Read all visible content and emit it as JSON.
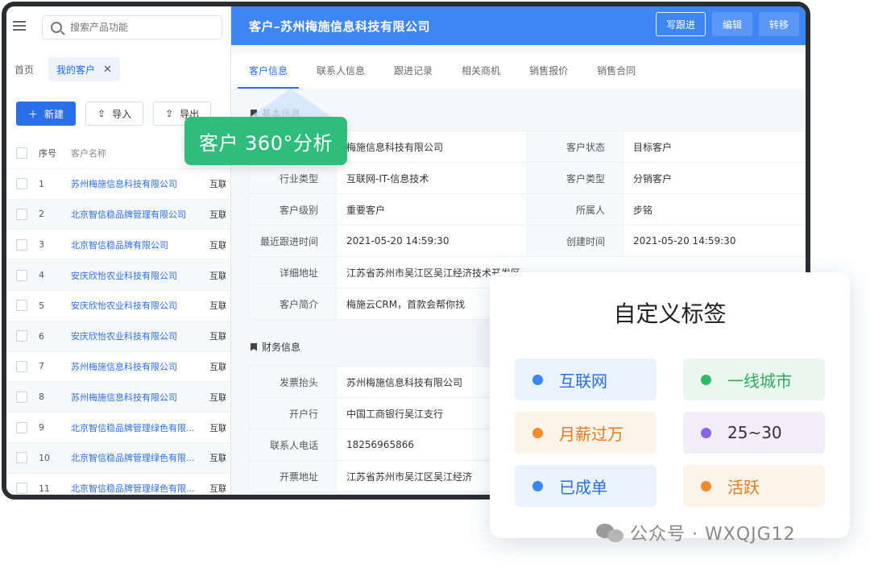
{
  "sidebar": {
    "search_placeholder": "搜索产品功能",
    "tabs": {
      "home": "首页",
      "my_customers": "我的客户",
      "close": "✕"
    },
    "toolbar": {
      "new": "新建",
      "import": "导入",
      "export": "导出"
    },
    "table": {
      "headers": {
        "index": "序号",
        "name": "客户名称"
      },
      "rows": [
        {
          "index": "1",
          "name": "苏州梅施信息科技有限公司",
          "industry": "互联"
        },
        {
          "index": "2",
          "name": "北京智信稳品牌管理有限公司",
          "industry": "互联"
        },
        {
          "index": "3",
          "name": "北京智信稳品牌有限公司",
          "industry": "互联"
        },
        {
          "index": "4",
          "name": "安庆欣怡农业科技有限公司",
          "industry": "互联"
        },
        {
          "index": "5",
          "name": "安庆欣怡农业科技有限公司",
          "industry": "互联"
        },
        {
          "index": "6",
          "name": "安庆欣怡农业科技有限公司",
          "industry": "互联"
        },
        {
          "index": "7",
          "name": "苏州梅施信息科技有限公司",
          "industry": "互联"
        },
        {
          "index": "8",
          "name": "苏州梅施信息科技有限公司",
          "industry": "互联"
        },
        {
          "index": "9",
          "name": "北京智信稳品牌管理绿色有限...",
          "industry": "互联"
        },
        {
          "index": "10",
          "name": "北京智信稳品牌管理绿色有限...",
          "industry": "互联"
        },
        {
          "index": "11",
          "name": "北京智信稳品牌管理绿色有限...",
          "industry": "互联"
        }
      ]
    }
  },
  "detail": {
    "title": "客户–苏州梅施信息科技有限公司",
    "actions": {
      "follow": "写跟进",
      "edit": "编辑",
      "transfer": "转移"
    },
    "subtabs": [
      "客户信息",
      "联系人信息",
      "跟进记录",
      "相关商机",
      "销售报价",
      "销售合同"
    ],
    "basic_section": "基本信息",
    "basic": {
      "company": "梅施信息科技有限公司",
      "status_label": "客户状态",
      "status_value": "目标客户",
      "industry_label": "行业类型",
      "industry_value": "互联网-IT-信息技术",
      "type_label": "客户类型",
      "type_value": "分销客户",
      "level_label": "客户级别",
      "level_value": "重要客户",
      "owner_label": "所属人",
      "owner_value": "步铭",
      "last_follow_label": "最近跟进时间",
      "last_follow_value": "2021-05-20 14:59:30",
      "created_label": "创建时间",
      "created_value": "2021-05-20 14:59:30",
      "address_label": "详细地址",
      "address_value": "江苏省苏州市吴江区吴江经济技术开发区",
      "intro_label": "客户简介",
      "intro_value": "梅施云CRM，首款会帮你找"
    },
    "finance_section": "财务信息",
    "finance": {
      "invoice_label": "发票抬头",
      "invoice_value": "苏州梅施信息科技有限公司",
      "bank_label": "开户行",
      "bank_value": "中国工商银行吴江支行",
      "phone_label": "联系人电话",
      "phone_value": "18256965866",
      "bill_addr_label": "开票地址",
      "bill_addr_value": "江苏省苏州市吴江区吴江经济"
    }
  },
  "callout": {
    "text": "客户 360°分析"
  },
  "tags_card": {
    "title": "自定义标签",
    "tags": [
      {
        "label": "互联网",
        "color": "#3b86f0",
        "bg": "#e9f2fd",
        "text_color": "#2d6fd8"
      },
      {
        "label": "一线城市",
        "color": "#2fbb61",
        "bg": "#e9f7ee",
        "text_color": "#2fa85a"
      },
      {
        "label": "月薪过万",
        "color": "#f08a2c",
        "bg": "#fdf3e8",
        "text_color": "#e07b1a"
      },
      {
        "label": "25~30",
        "color": "#8b63e6",
        "bg": "#f1edfb",
        "text_color": "#333333"
      },
      {
        "label": "已成单",
        "color": "#3b86f0",
        "bg": "#e9f2fd",
        "text_color": "#2d6fd8"
      },
      {
        "label": "活跃",
        "color": "#f08a2c",
        "bg": "#fdf3e8",
        "text_color": "#e07b1a"
      }
    ]
  },
  "watermark": {
    "text": "公众号 · WXQJG12"
  }
}
